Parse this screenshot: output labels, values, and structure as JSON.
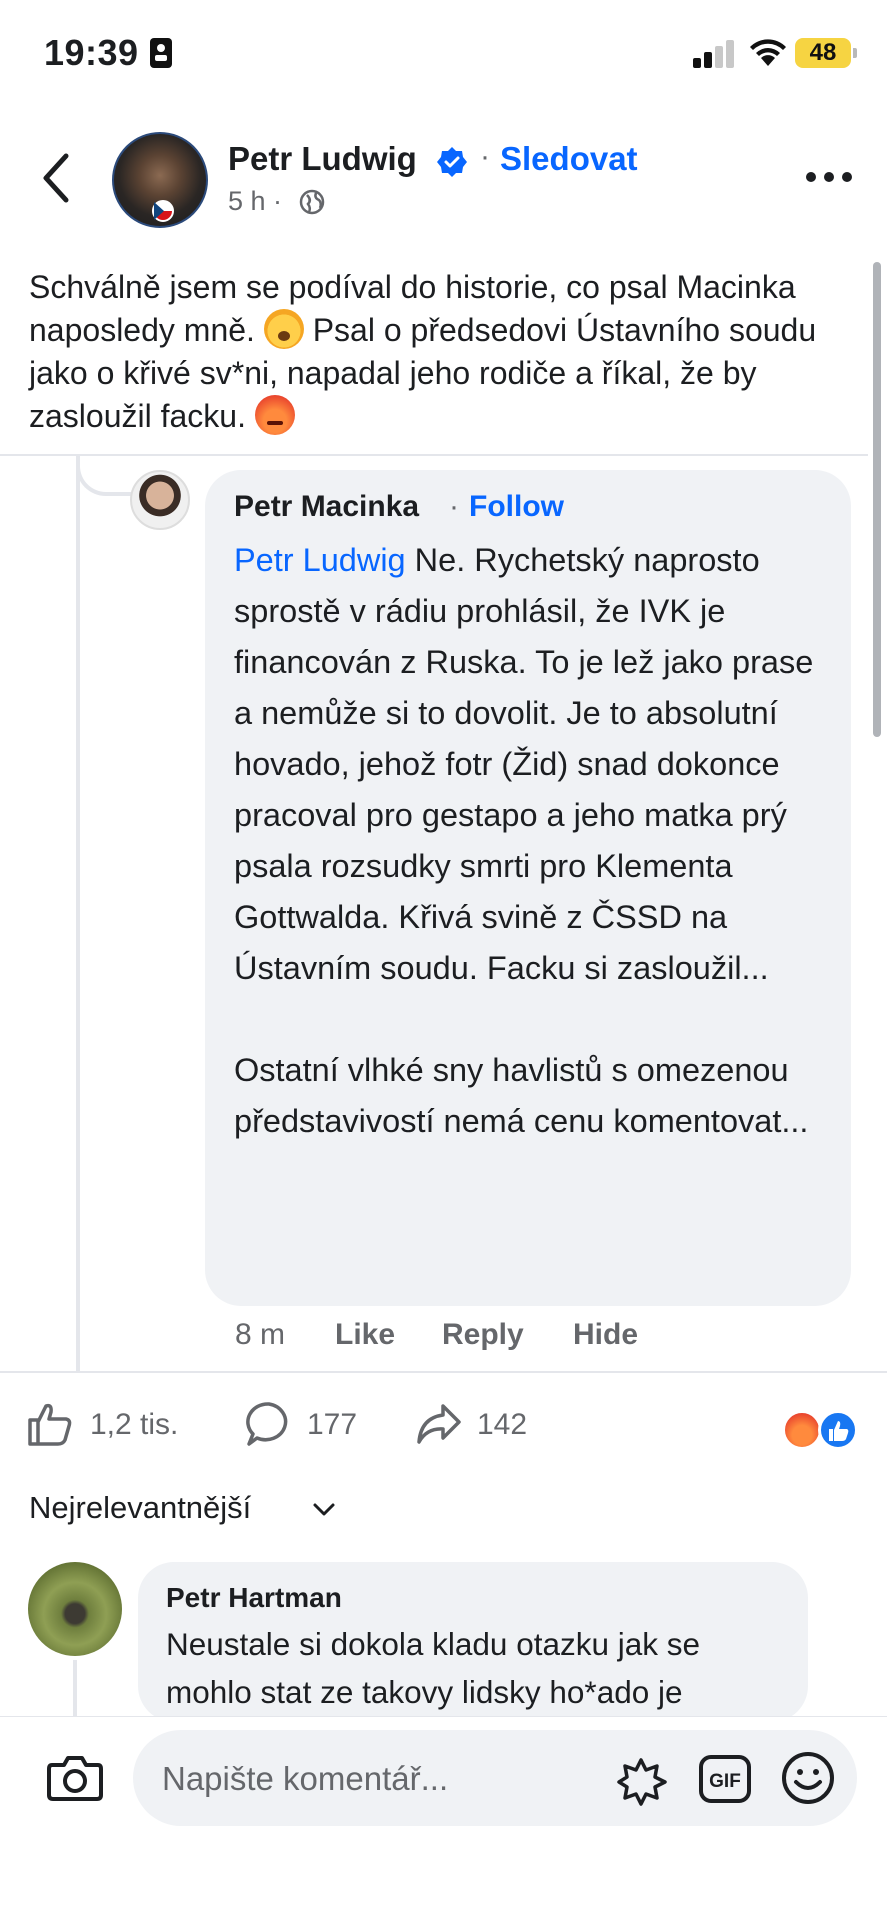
{
  "status_bar": {
    "time": "19:39",
    "battery": "48",
    "battery_color": "#f6d442"
  },
  "post": {
    "author": "Petr Ludwig",
    "follow_label": "Sledovat",
    "separator": "·",
    "time": "5 h ·",
    "text": "Schválně jsem se podíval do historie, co psal Macinka naposledy mně.",
    "text_part2": " Psal o předsedovi Ústavního soudu jako o křivé sv*ni, napadal jeho rodiče a říkal, že by zasloužil facku.",
    "icons": {
      "back": "chevron-left-icon",
      "verified": "verified-badge-icon",
      "globe": "globe-icon",
      "more": "more-dots-icon"
    }
  },
  "quoted_comment": {
    "author": "Petr Macinka",
    "separator": "·",
    "follow_label": "Follow",
    "mention": "Petr Ludwig",
    "text": " Ne. Rychetský naprosto sprostě v rádiu prohlásil, že IVK je financován z Ruska. To je lež jako prase a nemůže si to dovolit. Je to absolutní hovado, jehož fotr (Žid) snad dokonce pracoval pro gestapo a jeho matka prý psala rozsudky smrti pro Klementa Gottwalda. Křivá svině z ČSSD na Ústavním soudu. Facku si zasloužil...\n\nOstatní vlhké sny havlistů s omezenou představivostí nemá cenu komentovat...",
    "time": "8 m",
    "actions": [
      "Like",
      "Reply",
      "Hide"
    ]
  },
  "reactions": {
    "likes": "1,2 tis.",
    "comments": "177",
    "shares": "142",
    "like_color": "#1877f2",
    "angry_color": "#e8412d"
  },
  "comments_sort": {
    "label": "Nejrelevantnější"
  },
  "comment_2": {
    "author": "Petr Hartman",
    "text": "Neustale si dokola kladu otazku jak se\nmohlo stat ze takovy lidsky ho*ado je"
  },
  "composer": {
    "placeholder": "Napište komentář..."
  },
  "colors": {
    "accent": "#0866ff",
    "bubble": "#f0f2f5",
    "secondary_text": "#65676b"
  }
}
